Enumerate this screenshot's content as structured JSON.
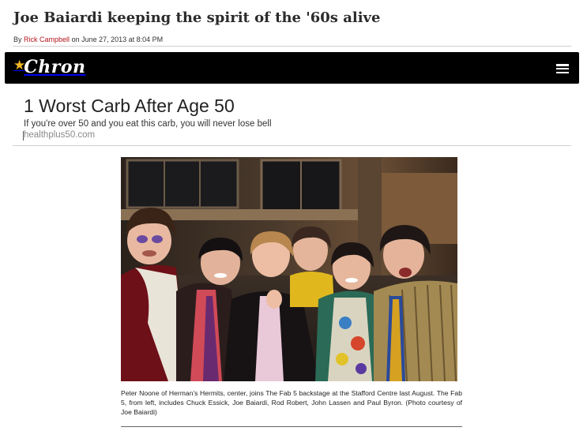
{
  "article": {
    "headline": "Joe Baiardi keeping the spirit of the '60s alive",
    "byline_prefix": "By",
    "author": "Rick Campbell",
    "byline_suffix": "on June 27, 2013 at 8:04 PM"
  },
  "brand_bar": {
    "logo_text": "Chron",
    "logo_icon": "star-icon",
    "menu_icon": "hamburger-menu-icon",
    "accent_color": "#f2b826",
    "bar_color": "#000000"
  },
  "sponsored": {
    "title": "1 Worst Carb After Age 50",
    "description": "If you're over 50 and you eat this carb, you will never lose bell",
    "source": "healthplus50.com"
  },
  "photo": {
    "caption": "Peter Noone of Herman's Hermits, center,  joins The Fab 5 backstage at the Stafford Centre last August. The Fab 5, from left, includes Chuck Essick, Joe Baiardi, Rod Robert, John Lassen and Paul Byron. (Photo courtesy of Joe Baiardi)"
  },
  "colors": {
    "author_link": "#b5121b",
    "source_text": "#8a8a8a"
  }
}
